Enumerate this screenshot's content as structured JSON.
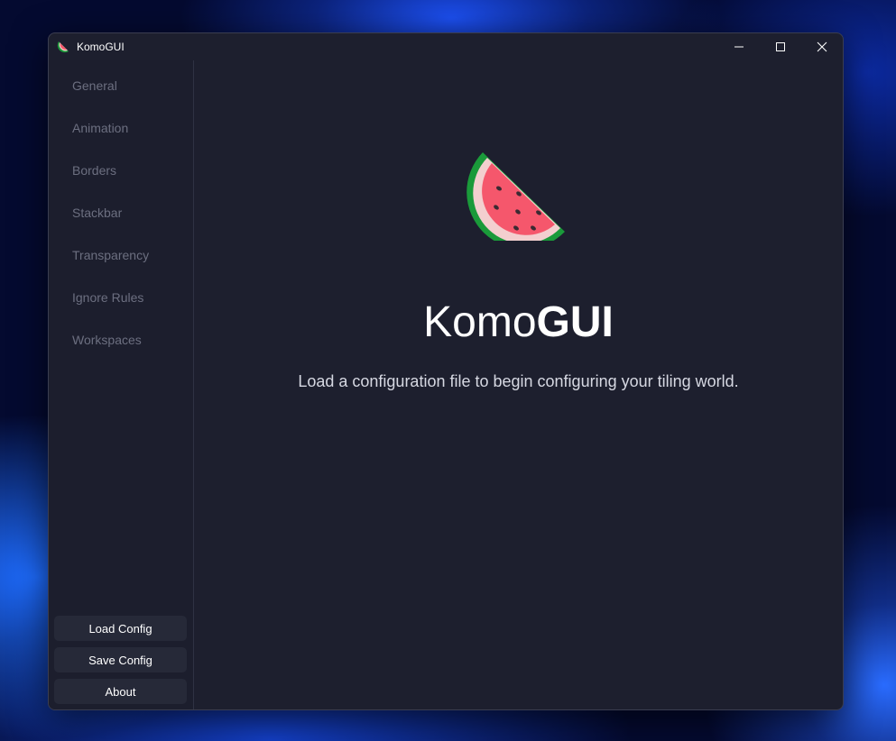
{
  "window": {
    "title": "KomoGUI",
    "app_icon": "watermelon-icon"
  },
  "controls": {
    "minimize_icon": "minimize-icon",
    "maximize_icon": "maximize-icon",
    "close_icon": "close-icon"
  },
  "sidebar": {
    "items": [
      {
        "label": "General"
      },
      {
        "label": "Animation"
      },
      {
        "label": "Borders"
      },
      {
        "label": "Stackbar"
      },
      {
        "label": "Transparency"
      },
      {
        "label": "Ignore Rules"
      },
      {
        "label": "Workspaces"
      }
    ],
    "buttons": {
      "load": "Load Config",
      "save": "Save Config",
      "about": "About"
    }
  },
  "main": {
    "logo_icon": "watermelon-icon",
    "heading_regular": "Komo",
    "heading_bold": "GUI",
    "subtitle": "Load a configuration file to begin configuring your tiling world."
  },
  "colors": {
    "window_bg": "#1d1f2e",
    "sidebar_text": "#6c6f80",
    "button_bg": "#262938",
    "watermelon_rind": "#1a9a3a",
    "watermelon_flesh": "#f5576c"
  }
}
